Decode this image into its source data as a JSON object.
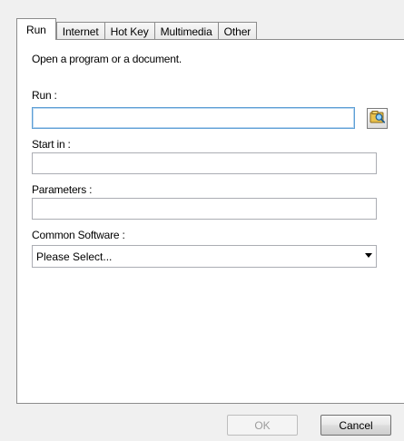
{
  "tabs": [
    {
      "label": "Run",
      "active": true
    },
    {
      "label": "Internet",
      "active": false
    },
    {
      "label": "Hot Key",
      "active": false
    },
    {
      "label": "Multimedia",
      "active": false
    },
    {
      "label": "Other",
      "active": false
    }
  ],
  "panel": {
    "description": "Open a program or a document.",
    "run_label": "Run :",
    "run_value": "",
    "start_in_label": "Start in :",
    "start_in_value": "",
    "parameters_label": "Parameters :",
    "parameters_value": "",
    "common_software_label": "Common Software :",
    "common_software_selected": "Please Select..."
  },
  "buttons": {
    "ok": "OK",
    "cancel": "Cancel"
  },
  "icons": {
    "browse": "folder-search-icon",
    "dropdown": "chevron-down-icon"
  }
}
